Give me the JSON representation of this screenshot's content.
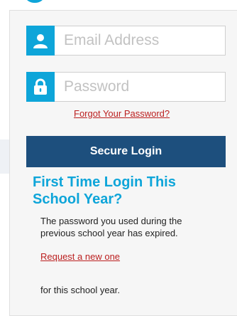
{
  "login_form": {
    "email_placeholder": "Email Address",
    "email_icon": "user-icon",
    "password_placeholder": "Password",
    "password_icon": "lock-icon",
    "forgot_password_label": "Forgot Your Password?",
    "submit_label": "Secure Login"
  },
  "first_time": {
    "heading": "First Time Login This School Year?",
    "message": "The password you used during the previous school year has expired.",
    "request_link_label": "Request a new one",
    "suffix": "for this school year."
  },
  "colors": {
    "accent": "#0ea5d9",
    "button": "#1d4f7d",
    "link": "#bb1f1f"
  }
}
